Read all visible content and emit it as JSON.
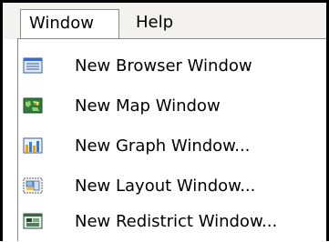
{
  "menubar": {
    "window_label": "Window",
    "help_label": "Help"
  },
  "window_menu": {
    "items": [
      {
        "label": "New Browser Window",
        "icon": "browser-window-icon"
      },
      {
        "label": "New Map Window",
        "icon": "map-window-icon"
      },
      {
        "label": "New Graph Window...",
        "icon": "graph-window-icon"
      },
      {
        "label": "New Layout Window...",
        "icon": "layout-window-icon"
      },
      {
        "label": "New Redistrict Window...",
        "icon": "redistrict-window-icon"
      }
    ]
  },
  "colors": {
    "menubar_bg": "#f3f2ee",
    "menu_bg": "#ffffff",
    "border": "#8a8a8a",
    "frame": "#000000"
  }
}
